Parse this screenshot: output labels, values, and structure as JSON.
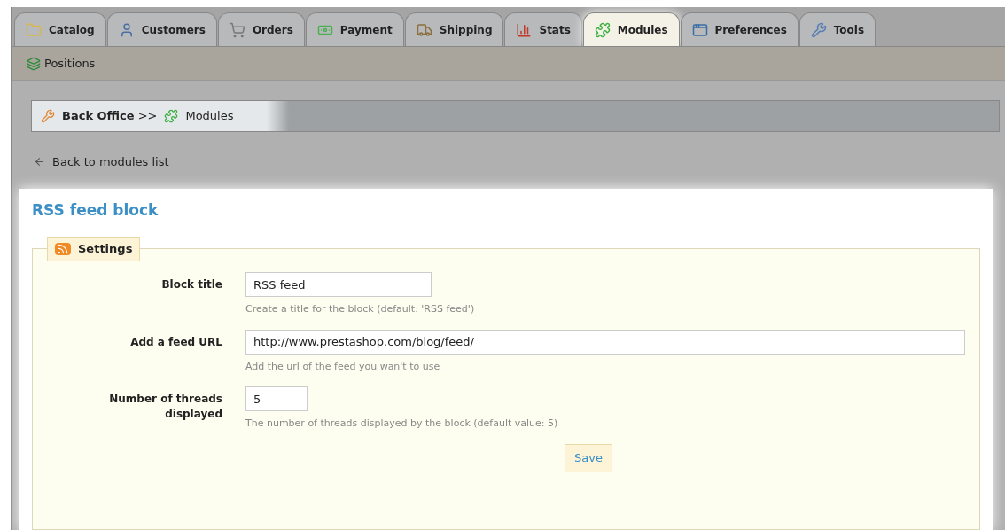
{
  "tabs": [
    {
      "label": "Catalog",
      "selected": false
    },
    {
      "label": "Customers",
      "selected": false
    },
    {
      "label": "Orders",
      "selected": false
    },
    {
      "label": "Payment",
      "selected": false
    },
    {
      "label": "Shipping",
      "selected": false
    },
    {
      "label": "Stats",
      "selected": false
    },
    {
      "label": "Modules",
      "selected": true
    },
    {
      "label": "Preferences",
      "selected": false
    },
    {
      "label": "Tools",
      "selected": false
    }
  ],
  "subnav": {
    "items": [
      "Positions"
    ]
  },
  "breadcrumb": {
    "root": "Back Office",
    "separator": ">>",
    "current": "Modules"
  },
  "back_link": "Back to modules list",
  "page_title": "RSS feed block",
  "settings": {
    "legend": "Settings",
    "fields": [
      {
        "label": "Block title",
        "value": "RSS feed",
        "hint": "Create a title for the block (default: 'RSS feed')"
      },
      {
        "label": "Add a feed URL",
        "value": "http://www.prestashop.com/blog/feed/",
        "hint": "Add the url of the feed you wan't to use"
      },
      {
        "label": "Number of threads displayed",
        "value": "5",
        "hint": "The number of threads displayed by the block (default value: 5)"
      }
    ],
    "save_button": "Save"
  }
}
